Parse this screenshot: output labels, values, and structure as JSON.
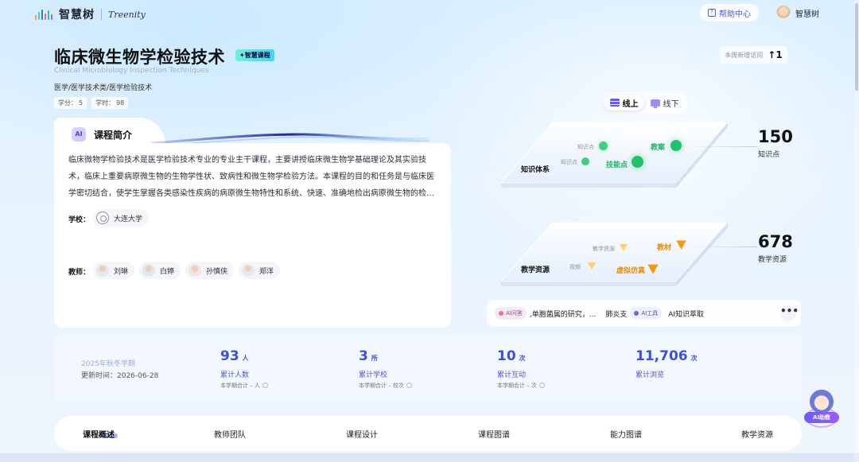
{
  "header": {
    "logo_cn": "智慧树",
    "logo_en": "Treenity",
    "help_label": "帮助中心",
    "user_name": "智慧树"
  },
  "course": {
    "title": "临床微生物学检验技术",
    "badge": "✦智慧课程",
    "title_en": "Clinical Microbiology Inspection Techniques",
    "breadcrumb": "医学/医学技术类/医学检验技术",
    "credit_label": "学分：",
    "credit_value": "5",
    "hours_label": "学时：",
    "hours_value": "98"
  },
  "visits": {
    "label": "本周新增访问",
    "value": "↑1"
  },
  "intro": {
    "ai_icon": "AI",
    "title": "课程简介",
    "text": "临床微物学检验技术是医学检验技术专业的专业主干课程，主要讲授临床微生物学基础理论及其实验技术，临床上重要病原微生物的生物学性状、致病性和微生物学检验方法。本课程的目的和任务是与临床医学密切结合，使学生掌握各类感染性疾病的病原微生物特性和系统、快速、准确地检出病原微生物的检验方法。",
    "school_label": "学校：",
    "school_name": "大连大学",
    "teacher_label": "教师：",
    "teachers": [
      "刘琳",
      "白婷",
      "孙慎侠",
      "郑洋"
    ]
  },
  "toggle": {
    "online": "线上",
    "offline": "线下"
  },
  "knowledge": {
    "label": "知识体系",
    "small1": "知识点",
    "small2": "知识点",
    "big1": "教案",
    "big2": "技能点",
    "count": "150",
    "count_label": "知识点"
  },
  "resources": {
    "label": "教学资源",
    "small1": "教学资源",
    "small2": "视频",
    "big1": "教材",
    "big2": "虚拟仿真",
    "count": "678",
    "count_label": "教学资源"
  },
  "ai_strip": {
    "qa_label": "AI问答",
    "qa_text": ",单胞菌属的研究，...",
    "mid_text": "肺炎支",
    "tool_label": "AI工具",
    "tool_text": "AI知识萃取",
    "more": "•••"
  },
  "stats": {
    "term": "2025年秋冬学期",
    "updated": "更新时间：2026-06-28",
    "items": [
      {
        "value": "93",
        "unit": "人",
        "label": "累计人数",
        "sub": "本学期合计 – 人"
      },
      {
        "value": "3",
        "unit": "所",
        "label": "累计学校",
        "sub": "本学期合计 – 校次"
      },
      {
        "value": "10",
        "unit": "次",
        "label": "累计互动",
        "sub": "本学期合计 – 次"
      },
      {
        "value": "11,706",
        "unit": "次",
        "label": "累计浏览",
        "sub": ""
      }
    ]
  },
  "nav": {
    "items": [
      "课程概述",
      "教师团队",
      "课程设计",
      "课程图谱",
      "能力图谱",
      "教学资源"
    ]
  },
  "assistant": {
    "label": "AI助教"
  },
  "colors": {
    "accent": "#3d4fd8",
    "green": "#22c26b",
    "orange": "#f59a0a"
  }
}
